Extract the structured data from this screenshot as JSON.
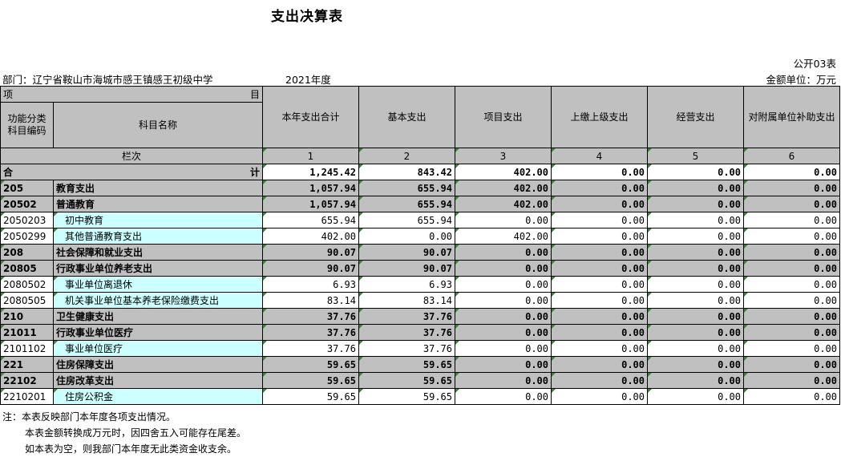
{
  "title": "支出决算表",
  "report_no": "公开03表",
  "department": "部门：辽宁省鞍山市海城市感王镇感王初级中学",
  "year": "2021年度",
  "unit": "金额单位：万元",
  "header": {
    "xiang": "项",
    "mu": "目",
    "code_col": "功能分类科目编码",
    "name_col": "科目名称",
    "columns": [
      "本年支出合计",
      "基本支出",
      "项目支出",
      "上缴上级支出",
      "经营支出",
      "对附属单位补助支出"
    ],
    "lanci": "栏次",
    "lanci_nums": [
      "1",
      "2",
      "3",
      "4",
      "5",
      "6"
    ]
  },
  "total": {
    "he": "合",
    "ji": "计",
    "values": [
      "1,245.42",
      "843.42",
      "402.00",
      "0.00",
      "0.00",
      "0.00"
    ]
  },
  "rows": [
    {
      "code": "205",
      "name": "教育支出",
      "level": "bold",
      "values": [
        "1,057.94",
        "655.94",
        "402.00",
        "0.00",
        "0.00",
        "0.00"
      ]
    },
    {
      "code": "20502",
      "name": "普通教育",
      "level": "bold",
      "values": [
        "1,057.94",
        "655.94",
        "402.00",
        "0.00",
        "0.00",
        "0.00"
      ]
    },
    {
      "code": "2050203",
      "name": "初中教育",
      "level": "leaf",
      "values": [
        "655.94",
        "655.94",
        "0.00",
        "0.00",
        "0.00",
        "0.00"
      ]
    },
    {
      "code": "2050299",
      "name": "其他普通教育支出",
      "level": "leaf",
      "values": [
        "402.00",
        "0.00",
        "402.00",
        "0.00",
        "0.00",
        "0.00"
      ]
    },
    {
      "code": "208",
      "name": "社会保障和就业支出",
      "level": "bold",
      "values": [
        "90.07",
        "90.07",
        "0.00",
        "0.00",
        "0.00",
        "0.00"
      ]
    },
    {
      "code": "20805",
      "name": "行政事业单位养老支出",
      "level": "bold",
      "values": [
        "90.07",
        "90.07",
        "0.00",
        "0.00",
        "0.00",
        "0.00"
      ]
    },
    {
      "code": "2080502",
      "name": "事业单位离退休",
      "level": "leaf",
      "values": [
        "6.93",
        "6.93",
        "0.00",
        "0.00",
        "0.00",
        "0.00"
      ]
    },
    {
      "code": "2080505",
      "name": "机关事业单位基本养老保险缴费支出",
      "level": "leaf",
      "values": [
        "83.14",
        "83.14",
        "0.00",
        "0.00",
        "0.00",
        "0.00"
      ]
    },
    {
      "code": "210",
      "name": "卫生健康支出",
      "level": "bold",
      "values": [
        "37.76",
        "37.76",
        "0.00",
        "0.00",
        "0.00",
        "0.00"
      ]
    },
    {
      "code": "21011",
      "name": "行政事业单位医疗",
      "level": "bold",
      "values": [
        "37.76",
        "37.76",
        "0.00",
        "0.00",
        "0.00",
        "0.00"
      ]
    },
    {
      "code": "2101102",
      "name": "事业单位医疗",
      "level": "leaf",
      "values": [
        "37.76",
        "37.76",
        "0.00",
        "0.00",
        "0.00",
        "0.00"
      ]
    },
    {
      "code": "221",
      "name": "住房保障支出",
      "level": "bold",
      "values": [
        "59.65",
        "59.65",
        "0.00",
        "0.00",
        "0.00",
        "0.00"
      ]
    },
    {
      "code": "22102",
      "name": "住房改革支出",
      "level": "bold",
      "values": [
        "59.65",
        "59.65",
        "0.00",
        "0.00",
        "0.00",
        "0.00"
      ]
    },
    {
      "code": "2210201",
      "name": "住房公积金",
      "level": "leaf",
      "values": [
        "59.65",
        "59.65",
        "0.00",
        "0.00",
        "0.00",
        "0.00"
      ]
    }
  ],
  "notes": [
    "注：本表反映部门本年度各项支出情况。",
    "本表金额转换成万元时，因四舍五入可能存在尾差。",
    "如本表为空，则我部门本年度无此类资金收支余。"
  ]
}
